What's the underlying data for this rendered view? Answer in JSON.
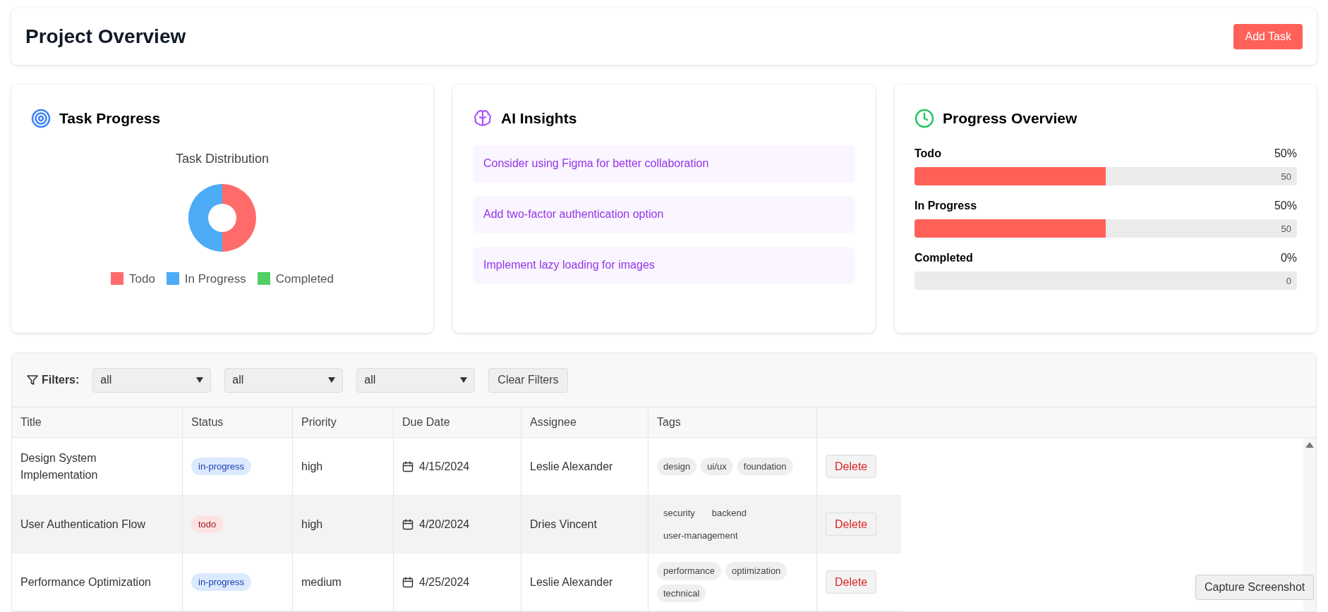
{
  "header": {
    "title": "Project Overview",
    "add_button": "Add Task"
  },
  "task_progress": {
    "title": "Task Progress",
    "chart_data": {
      "type": "donut",
      "title": "Task Distribution",
      "categories": [
        "Todo",
        "In Progress",
        "Completed"
      ],
      "series": [
        {
          "values": [
            50,
            50,
            0
          ]
        }
      ],
      "legend": "bottom",
      "colors": [
        "#ff6b6b",
        "#4dabf7",
        "#51cf66"
      ]
    }
  },
  "ai_insights": {
    "title": "AI Insights",
    "items": [
      "Consider using Figma for better collaboration",
      "Add two-factor authentication option",
      "Implement lazy loading for images"
    ]
  },
  "progress_overview": {
    "title": "Progress Overview",
    "items": [
      {
        "label": "Todo",
        "percent": "50%",
        "level": 0.5,
        "reading": "50"
      },
      {
        "label": "In Progress",
        "percent": "50%",
        "level": 0.5,
        "reading": "50"
      },
      {
        "label": "Completed",
        "percent": "0%",
        "level": 0,
        "reading": "0"
      }
    ]
  },
  "filters": {
    "label": "Filters:",
    "dropdowns": [
      "all",
      "all",
      "all"
    ],
    "clear_button": "Clear Filters"
  },
  "table": {
    "columns": [
      "Title",
      "Status",
      "Priority",
      "Due Date",
      "Assignee",
      "Tags"
    ],
    "rows": [
      {
        "selected": false,
        "title": "Design System Implementation",
        "status": {
          "text": "in-progress",
          "color": "#dbeafe"
        },
        "priority": "high",
        "due_date": "4/15/2024",
        "assignee": "Leslie Alexander",
        "tags": [
          "design",
          "ui/ux",
          "foundation"
        ],
        "action": "Delete"
      },
      {
        "selected": true,
        "title": "User Authentication Flow",
        "status": {
          "text": "todo",
          "color": "#fee2e2"
        },
        "priority": "high",
        "due_date": "4/20/2024",
        "assignee": "Dries Vincent",
        "tags": [
          "security",
          "backend",
          "user-management"
        ],
        "action": "Delete"
      },
      {
        "selected": false,
        "title": "Performance Optimization",
        "status": {
          "text": "in-progress",
          "color": "#dbeafe"
        },
        "priority": "medium",
        "due_date": "4/25/2024",
        "assignee": "Leslie Alexander",
        "tags": [
          "performance",
          "optimization",
          "technical"
        ],
        "action": "Delete"
      }
    ]
  },
  "capture_button": "Capture Screenshot"
}
